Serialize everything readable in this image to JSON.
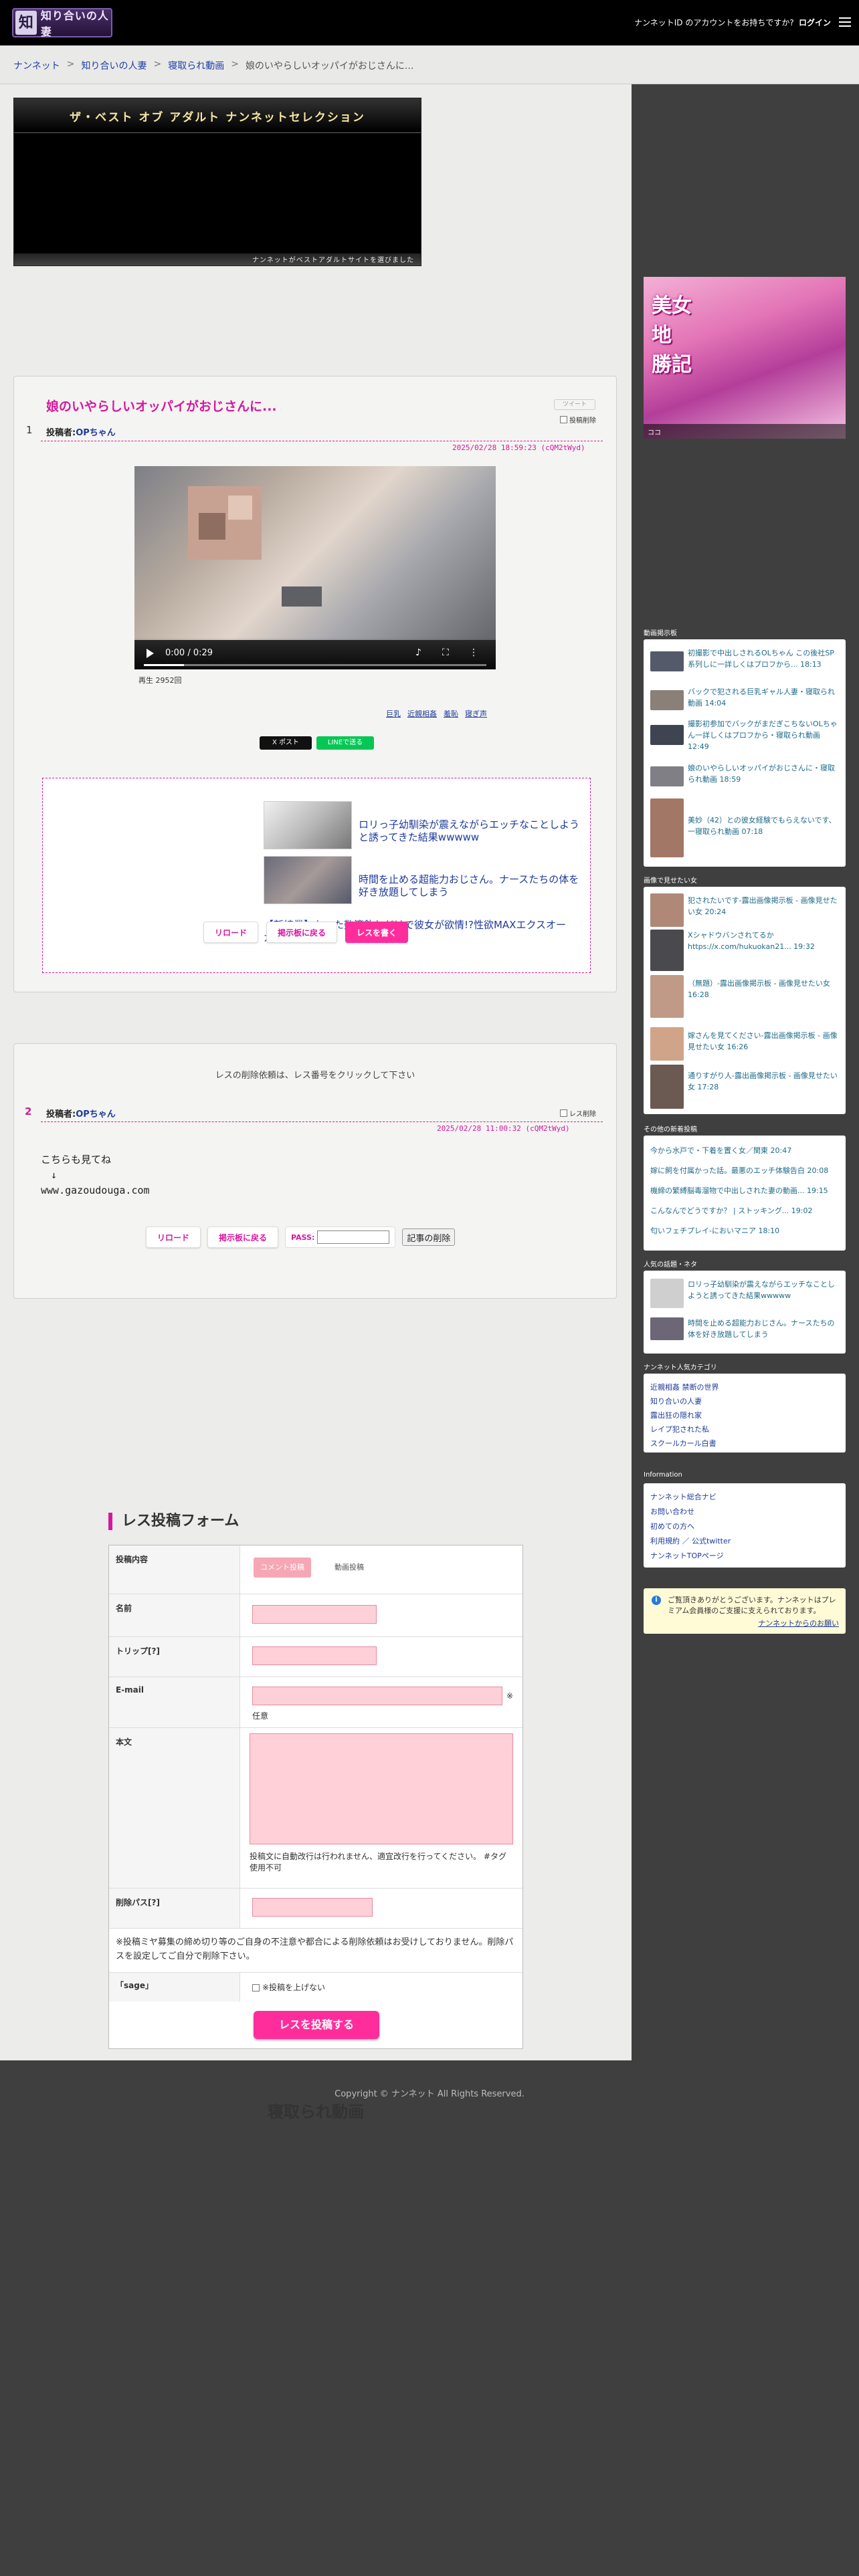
{
  "header": {
    "logo_text": "知り合いの人妻",
    "logo_mark": "知",
    "account_question": "ナンネットID のアカウントをお持ちですか?",
    "login": "ログイン"
  },
  "breadcrumb": [
    "ナンネット",
    "知り合いの人妻",
    "寝取られ動画",
    "娘のいやらしいオッパイがおじさんに..."
  ],
  "banner": {
    "title": "ザ・ベスト オブ アダルト ナンネットセレクション",
    "subtitle": "ナンネットがベストアダルトサイトを選びました"
  },
  "thread": {
    "title": "娘のいやらしいオッパイがおじさんに...",
    "tweet_label": "ツイート",
    "delete_check": "投稿削除",
    "post1": {
      "no": "1",
      "poster_label": "投稿者:",
      "poster": "OPちゃん",
      "date": "2025/02/28 18:59:23 (cQM2tWyd)",
      "video_time": "0:00 / 0:29",
      "plays": "再生 2952回",
      "tags": [
        "巨乳",
        "近親相姦",
        "羞恥",
        "寝ぎ声"
      ],
      "share_x": "X ポスト",
      "share_line": "LINEで送る"
    },
    "ad": {
      "link1": "ロリっ子幼馴染が震えながらエッチなことしようと誘ってきた結果wwwww",
      "link2": "時間を止める超能力おじさん。ナースたちの体を好き放題してしまう",
      "link3": "【新編業】たった数滴飲むだけで彼女が欲情!?性欲MAXエクスオーガズム"
    },
    "buttons": {
      "reload": "リロード",
      "back": "掲示板に戻る",
      "reply": "レスを書く"
    },
    "delete_note": "レスの削除依頼は、レス番号をクリックして下さい",
    "post2": {
      "no": "2",
      "poster_label": "投稿者:",
      "poster": "OPちゃん",
      "delete_check": "レス削除",
      "date": "2025/02/28 11:00:32 (cQM2tWyd)",
      "body": "こちらも見てね\n　↓\nwww.gazoudouga.com"
    },
    "buttons2": {
      "reload": "リロード",
      "back": "掲示板に戻る",
      "pass": "PASS:",
      "delete": "記事の削除"
    }
  },
  "form": {
    "heading": "レス投稿フォーム",
    "content_label": "投稿内容",
    "tab_comment": "コメント投稿",
    "tab_video": "動画投稿",
    "name_label": "名前",
    "trip_label": "トリップ[?]",
    "email_label": "E-mail",
    "email_req": "※",
    "email_note": "任意",
    "body_label": "本文",
    "body_note": "投稿文に自動改行は行われません、適宜改行を行ってください。 #タグ使用不可",
    "delpass_label": "削除パス[?]",
    "warning": "※投稿ミヤ募集の締め切り等のご自身の不注意や都合による削除依頼はお受けしておりません。削除パスを設定してご自分で削除下さい。",
    "sage_label": "「sage」",
    "sage_option": "※投稿を上げない",
    "submit": "レスを投稿する"
  },
  "category_heading": "寝取られ動画",
  "footer": "Copyright © ナンネット All Rights Reserved.",
  "sidebar": {
    "ad_title_l1": "美女",
    "ad_title_l2": "地",
    "ad_title_l3": "勝記",
    "ad_bar": "ココ",
    "video_board": {
      "heading": "動画掲示板",
      "items": [
        "初撮影で中出しされるOLちゃん この後社SP系列しに一詳しくはプロフから... 18:13",
        "バックで犯される巨乳ギャル人妻・寝取られ動画 14:04",
        "撮影初参加でバックがまだぎこちないOLちゃん一詳しくはプロフから・寝取られ動画 12:49",
        "娘のいやらしいオッパイがおじさんに・寝取られ動画 18:59",
        "美妙（42）との彼女経験でもらえないです、一寝取られ動画 07:18"
      ]
    },
    "image_board": {
      "heading": "画像で見せたい女",
      "items": [
        "犯されたいです-露出画像掲示板 - 画像見せたい女 20:24",
        "Xシャドウバンされてるか https://x.com/hukuokan21... 19:32",
        "（無題）-露出画像掲示板 - 画像見せたい女 16:28",
        "嫁さんを見てください-露出画像掲示板 - 画像見せたい女 16:26",
        "通りすがり人-露出画像掲示板 - 画像見せたい女 17:28"
      ]
    },
    "new_posts": {
      "heading": "その他の新着投稿",
      "items": [
        "今から水戸で・下着を置く女／関東 20:47",
        "嫁に飼を付属かった話。最悪のエッチ体験告白 20:08",
        "機締の繁縛脳毒溜物で中出しされた妻の動画... 19:15",
        "こんなんでどうですか？ | ストッキング... 19:02",
        "匂いフェチプレイ-においマニア 18:10"
      ]
    },
    "popular": {
      "heading": "人気の話題・ネタ",
      "items": [
        "ロリっ子幼馴染が震えながらエッチなことしようと誘ってきた結果wwwww",
        "時間を止める超能力おじさん。ナースたちの体を好き放題してしまう"
      ]
    },
    "categories": {
      "heading": "ナンネット人気カテゴリ",
      "items": [
        "近親相姦 禁断の世界",
        "知り合いの人妻",
        "露出狂の隠れ家",
        "レイプ犯された私",
        "スクールカール白書"
      ]
    },
    "info": {
      "heading": "Information",
      "items": [
        "ナンネット総合ナビ",
        "お問い合わせ",
        "初めての方へ",
        "利用規約 ／ 公式twitter",
        "ナンネットTOPページ"
      ]
    },
    "notice": {
      "text": "ご覧頂きありがとうございます。ナンネットはプレミアム会員様のご支援に支えられております。",
      "link": "ナンネットからのお願い"
    }
  }
}
